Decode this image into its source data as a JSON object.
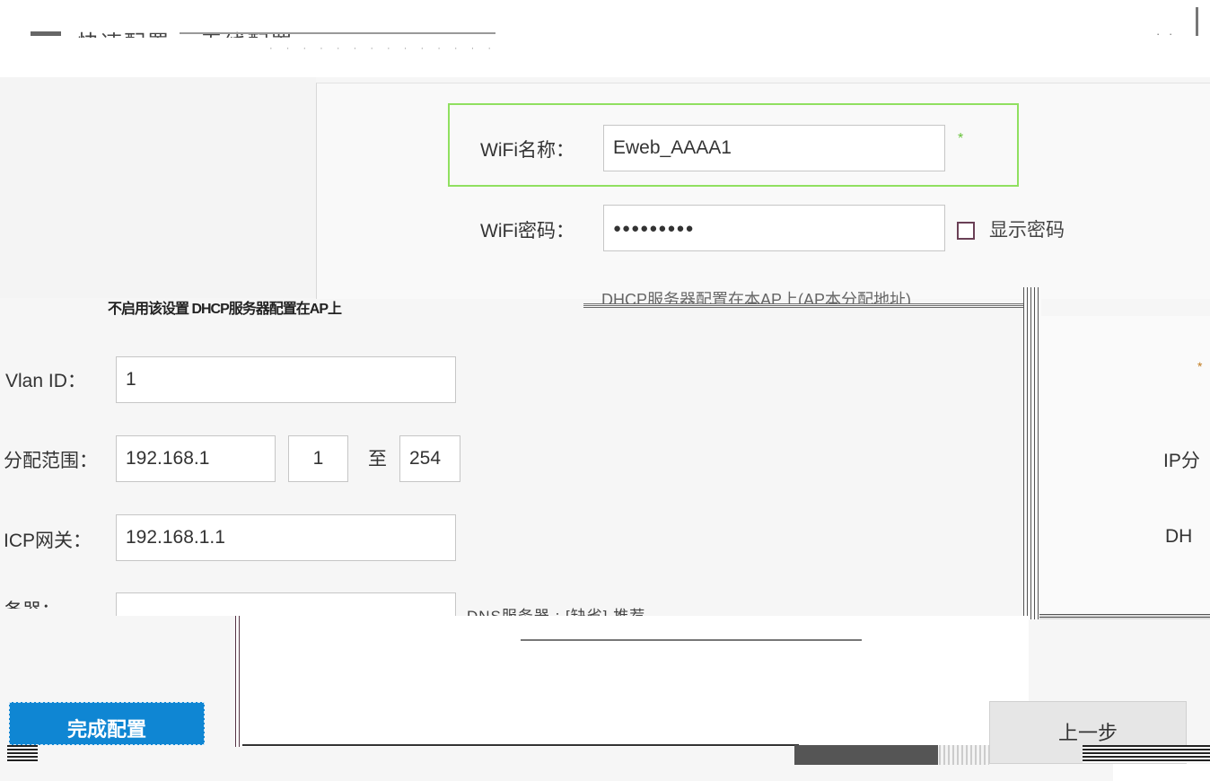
{
  "header": {
    "title_fragment": "快速配置 > 无线配置",
    "noise_text": "· · ·  ·  ·   ·   ·  ·    · ·  ·  ·  ·   ·",
    "window_controls": "· ·"
  },
  "wifi": {
    "name_label": "WiFi名称：",
    "name_value": "Eweb_AAAA1",
    "required_mark": "*",
    "password_label": "WiFi密码：",
    "password_value": "●●●●●●●●●",
    "show_password_label": "显示密码"
  },
  "overlay_texts": {
    "glitch_row": "不启用该设置 DHCP服务器配置在AP上",
    "dhcp_option": "DHCP服务器配置在本AP上(AP本分配地址)",
    "bottom_row": "DNS服务器 : [缺省] 推荐 …"
  },
  "dhcp": {
    "vlan_label": "Vlan ID：",
    "vlan_value": "1",
    "range_label": "分配范围：",
    "range_prefix": "192.168.1",
    "range_start": "1",
    "range_to": "至",
    "range_end": "254",
    "gateway_label": "ICP网关：",
    "gateway_value": "192.168.1.1",
    "dns_label": "务器："
  },
  "right_labels": {
    "ip_label": "IP分",
    "dh_label": "DH",
    "star": "*"
  },
  "buttons": {
    "finish": "完成配置",
    "previous": "上一步"
  }
}
